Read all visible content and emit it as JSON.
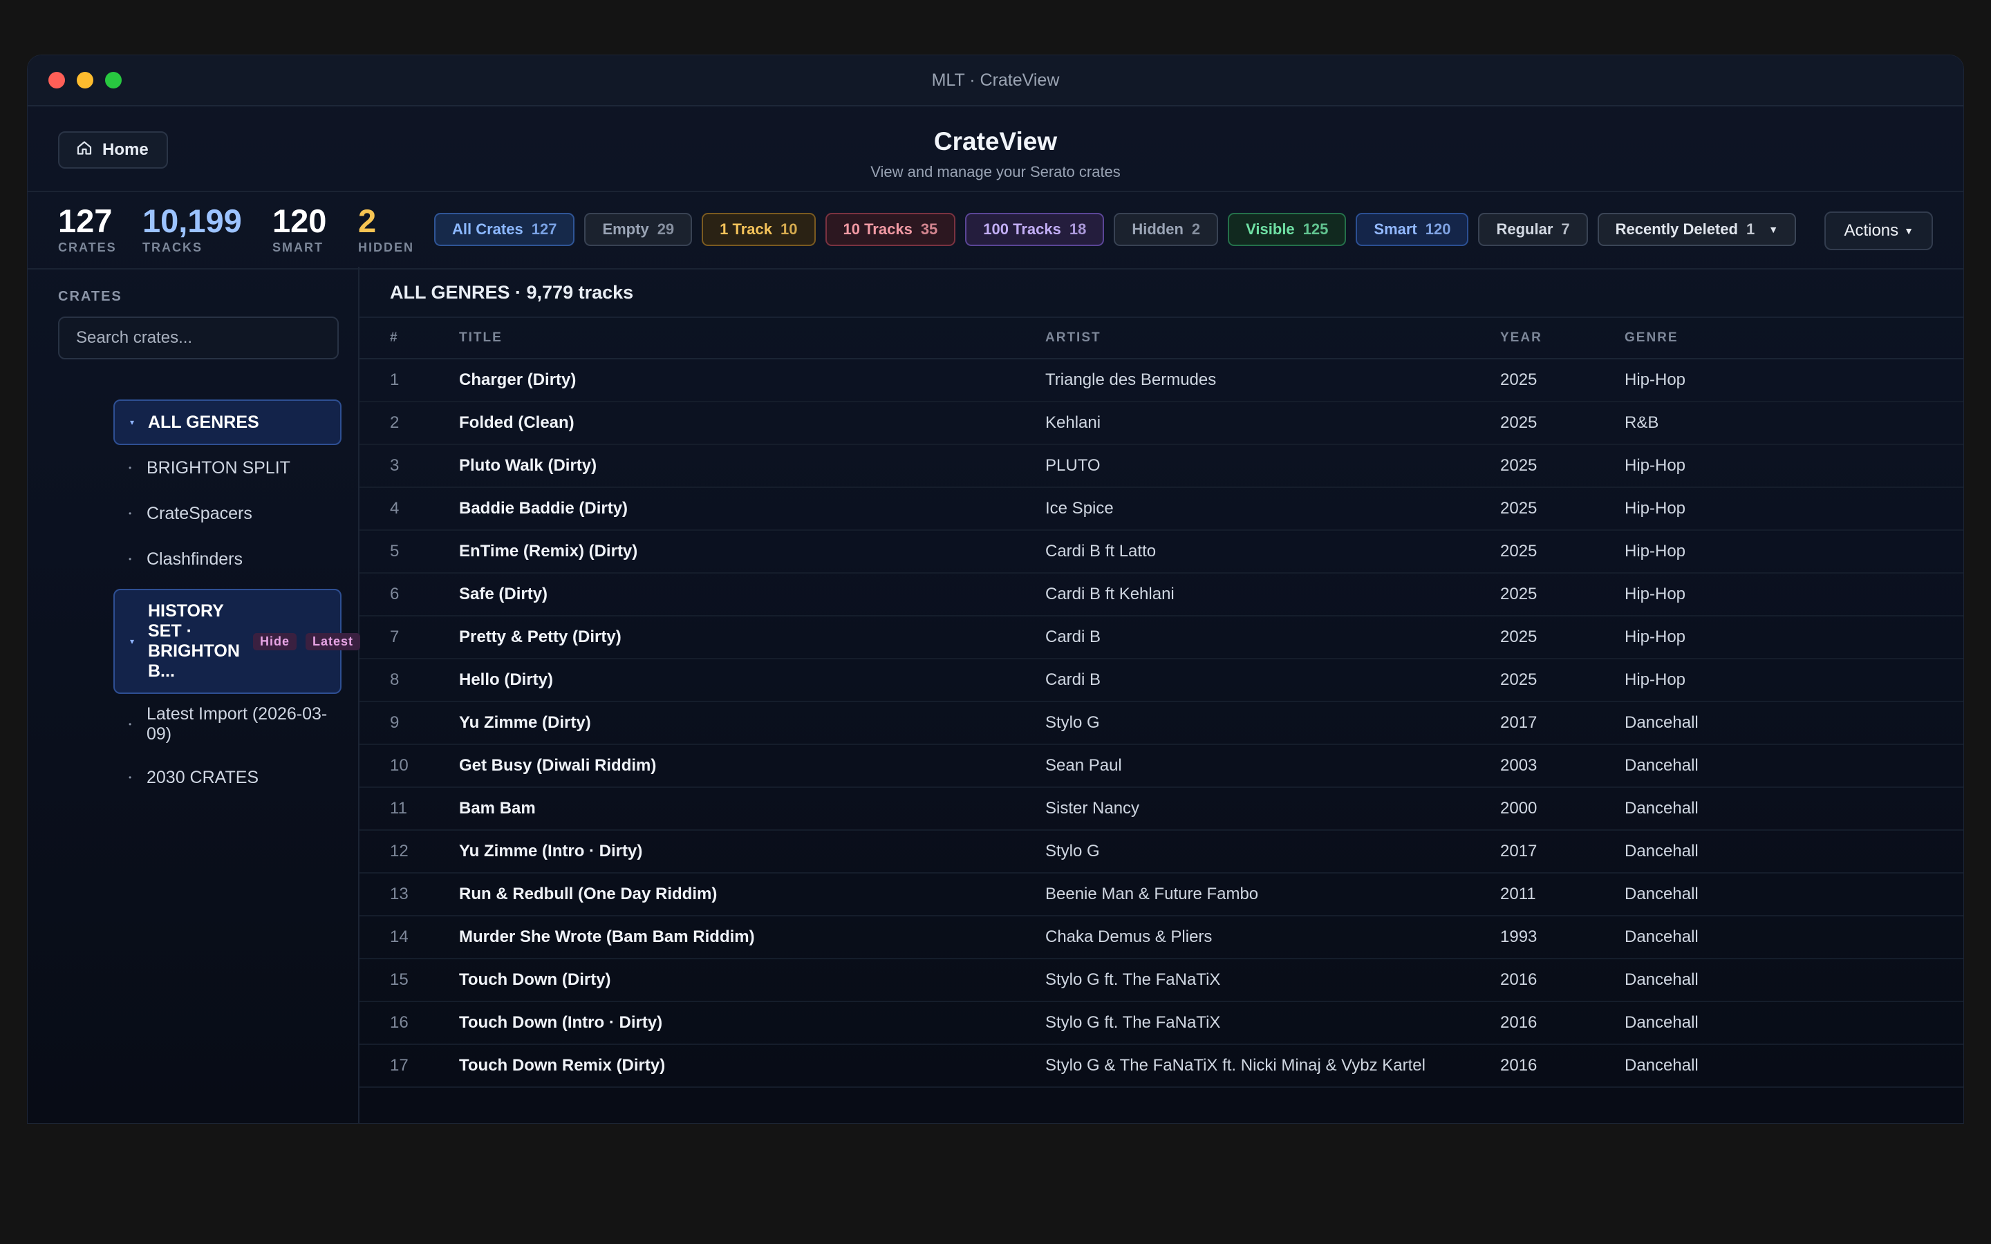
{
  "window": {
    "title": "MLT · CrateView"
  },
  "header": {
    "home_label": "Home",
    "title": "CrateView",
    "subtitle": "View and manage your Serato crates"
  },
  "stats": [
    {
      "value": "127",
      "label": "CRATES",
      "color": "#ffffff"
    },
    {
      "value": "10,199",
      "label": "TRACKS",
      "color": "#9cc3ff"
    },
    {
      "value": "120",
      "label": "SMART",
      "color": "#ffffff"
    },
    {
      "value": "2",
      "label": "HIDDEN",
      "color": "#f6c453"
    }
  ],
  "filters": [
    {
      "label": "All Crates",
      "count": "127",
      "style": "blue"
    },
    {
      "label": "Empty",
      "count": "29",
      "style": "gray"
    },
    {
      "label": "1 Track",
      "count": "10",
      "style": "amber"
    },
    {
      "label": "10 Tracks",
      "count": "35",
      "style": "red"
    },
    {
      "label": "100 Tracks",
      "count": "18",
      "style": "purple"
    },
    {
      "label": "Hidden",
      "count": "2",
      "style": "gray"
    },
    {
      "label": "Visible",
      "count": "125",
      "style": "green"
    },
    {
      "label": "Smart",
      "count": "120",
      "style": "navy"
    },
    {
      "label": "Regular",
      "count": "7",
      "style": "slate"
    },
    {
      "label": "Recently Deleted",
      "count": "1",
      "style": "dark"
    }
  ],
  "actions_label": "Actions",
  "sidebar": {
    "label": "CRATES",
    "search_placeholder": "Search crates...",
    "crates": [
      {
        "name": "ALL GENRES",
        "active": true,
        "bullet": "▾"
      },
      {
        "name": "BRIGHTON SPLIT",
        "bullet": "•"
      },
      {
        "name": "CrateSpacers",
        "bullet": "•"
      },
      {
        "name": "Clashfinders",
        "bullet": "•"
      },
      {
        "name": "HISTORY SET · BRIGHTON B...",
        "active": true,
        "bullet": "▾",
        "badges": [
          "Hide",
          "Latest"
        ]
      },
      {
        "name": "Latest Import (2026-03-09)",
        "bullet": "•"
      },
      {
        "name": "2030 CRATES",
        "bullet": "•"
      }
    ]
  },
  "main": {
    "heading": "ALL GENRES · 9,779 tracks",
    "columns": [
      "#",
      "TITLE",
      "ARTIST",
      "YEAR",
      "GENRE"
    ],
    "rows": [
      [
        "1",
        "Charger (Dirty)",
        "Triangle des Bermudes",
        "2025",
        "Hip-Hop"
      ],
      [
        "2",
        "Folded (Clean)",
        "Kehlani",
        "2025",
        "R&B"
      ],
      [
        "3",
        "Pluto Walk (Dirty)",
        "PLUTO",
        "2025",
        "Hip-Hop"
      ],
      [
        "4",
        "Baddie Baddie (Dirty)",
        "Ice Spice",
        "2025",
        "Hip-Hop"
      ],
      [
        "5",
        "EnTime (Remix) (Dirty)",
        "Cardi B ft Latto",
        "2025",
        "Hip-Hop"
      ],
      [
        "6",
        "Safe (Dirty)",
        "Cardi B ft Kehlani",
        "2025",
        "Hip-Hop"
      ],
      [
        "7",
        "Pretty & Petty (Dirty)",
        "Cardi B",
        "2025",
        "Hip-Hop"
      ],
      [
        "8",
        "Hello (Dirty)",
        "Cardi B",
        "2025",
        "Hip-Hop"
      ],
      [
        "9",
        "Yu Zimme (Dirty)",
        "Stylo G",
        "2017",
        "Dancehall"
      ],
      [
        "10",
        "Get Busy (Diwali Riddim)",
        "Sean Paul",
        "2003",
        "Dancehall"
      ],
      [
        "11",
        "Bam Bam",
        "Sister Nancy",
        "2000",
        "Dancehall"
      ],
      [
        "12",
        "Yu Zimme (Intro · Dirty)",
        "Stylo G",
        "2017",
        "Dancehall"
      ],
      [
        "13",
        "Run & Redbull (One Day Riddim)",
        "Beenie Man & Future Fambo",
        "2011",
        "Dancehall"
      ],
      [
        "14",
        "Murder She Wrote (Bam Bam Riddim)",
        "Chaka Demus & Pliers",
        "1993",
        "Dancehall"
      ],
      [
        "15",
        "Touch Down (Dirty)",
        "Stylo G ft. The FaNaTiX",
        "2016",
        "Dancehall"
      ],
      [
        "16",
        "Touch Down (Intro · Dirty)",
        "Stylo G ft. The FaNaTiX",
        "2016",
        "Dancehall"
      ],
      [
        "17",
        "Touch Down Remix (Dirty)",
        "Stylo G & The FaNaTiX ft. Nicki Minaj & Vybz Kartel",
        "2016",
        "Dancehall"
      ]
    ]
  }
}
